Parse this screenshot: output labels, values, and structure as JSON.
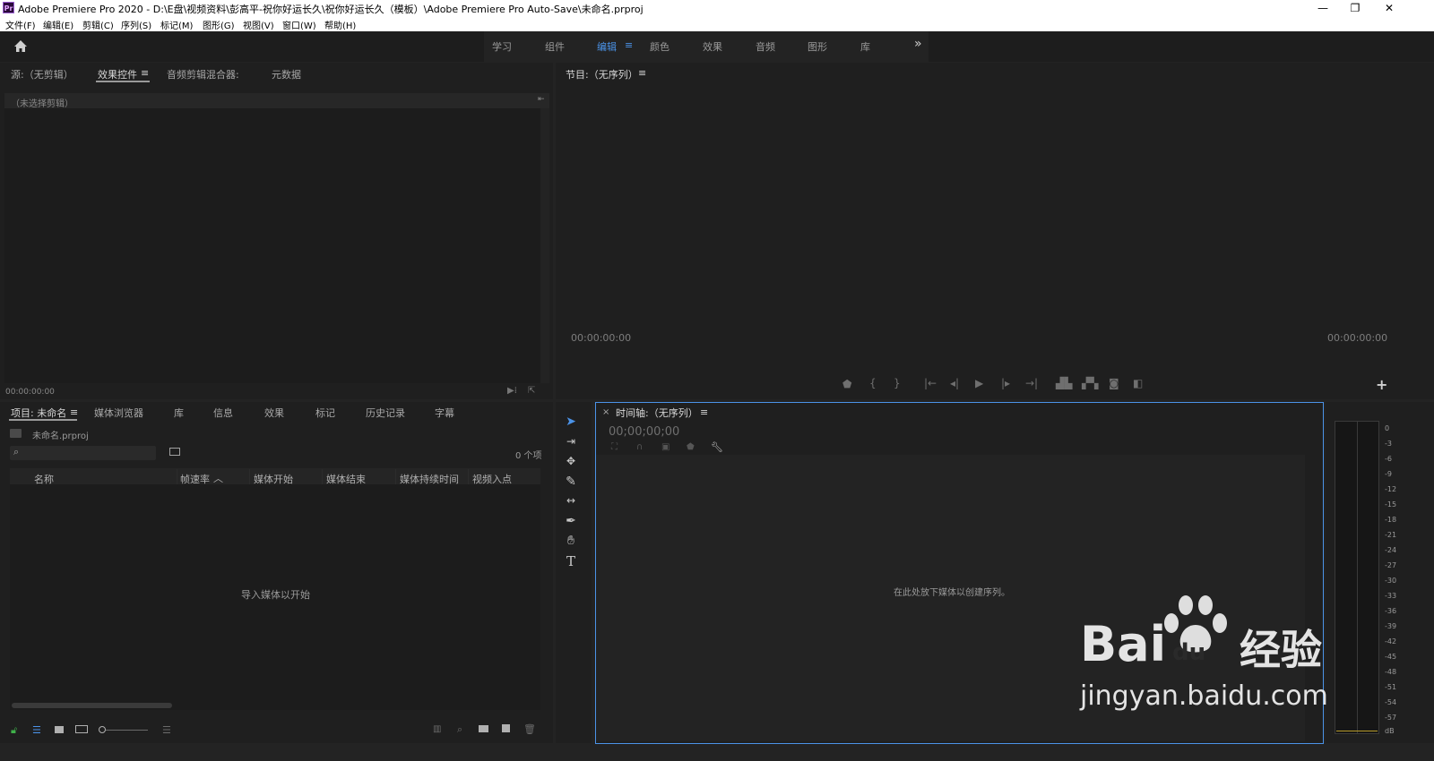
{
  "title_bar": {
    "logo_text": "Pr",
    "title": "Adobe Premiere Pro 2020 - D:\\E盘\\视频资料\\彭高平-祝你好运长久\\祝你好运长久（模板）\\Adobe Premiere Pro Auto-Save\\未命名.prproj",
    "minimize": "—",
    "restore": "❐",
    "close": "✕"
  },
  "menu": [
    "文件(F)",
    "编辑(E)",
    "剪辑(C)",
    "序列(S)",
    "标记(M)",
    "图形(G)",
    "视图(V)",
    "窗口(W)",
    "帮助(H)"
  ],
  "workspaces": {
    "tabs": [
      "学习",
      "组件",
      "编辑",
      "颜色",
      "效果",
      "音频",
      "图形",
      "库"
    ],
    "active": "编辑",
    "menu_glyph": "≡",
    "more": "»"
  },
  "source_panel": {
    "tabs": [
      "源:（无剪辑）",
      "效果控件",
      "音频剪辑混合器:",
      "元数据"
    ],
    "active_menu_glyph": "≡",
    "no_clip": "（未选择剪辑）",
    "timecode": "00:00:00:00"
  },
  "program_panel": {
    "title": "节目:（无序列）",
    "menu_glyph": "≡",
    "timecode_left": "00:00:00:00",
    "timecode_right": "00:00:00:00",
    "add": "+"
  },
  "project_panel": {
    "tabs": [
      "项目: 未命名",
      "媒体浏览器",
      "库",
      "信息",
      "效果",
      "标记",
      "历史记录",
      "字幕"
    ],
    "menu_glyph": "≡",
    "file_name": "未命名.prproj",
    "item_count": "0 个项",
    "columns": [
      "名称",
      "帧速率",
      "媒体开始",
      "媒体结束",
      "媒体持续时间",
      "视频入点"
    ],
    "empty_text": "导入媒体以开始"
  },
  "timeline_panel": {
    "close": "×",
    "title": "时间轴:（无序列）",
    "menu_glyph": "≡",
    "timecode": "00;00;00;00",
    "empty_text": "在此处放下媒体以创建序列。"
  },
  "audio_meter": {
    "labels": [
      "0",
      "-3",
      "-6",
      "-9",
      "-12",
      "-15",
      "-18",
      "-21",
      "-24",
      "-27",
      "-30",
      "-33",
      "-36",
      "-39",
      "-42",
      "-45",
      "-48",
      "-51",
      "-54",
      "-57",
      "dB"
    ]
  },
  "watermark": {
    "brand_left": "Bai",
    "brand_right": "du",
    "brand_cn": "经验",
    "url": "jingyan.baidu.com"
  },
  "colors": {
    "accent": "#4b93e8",
    "panel_bg": "#1f1f1f",
    "frame_bg": "#232323"
  }
}
